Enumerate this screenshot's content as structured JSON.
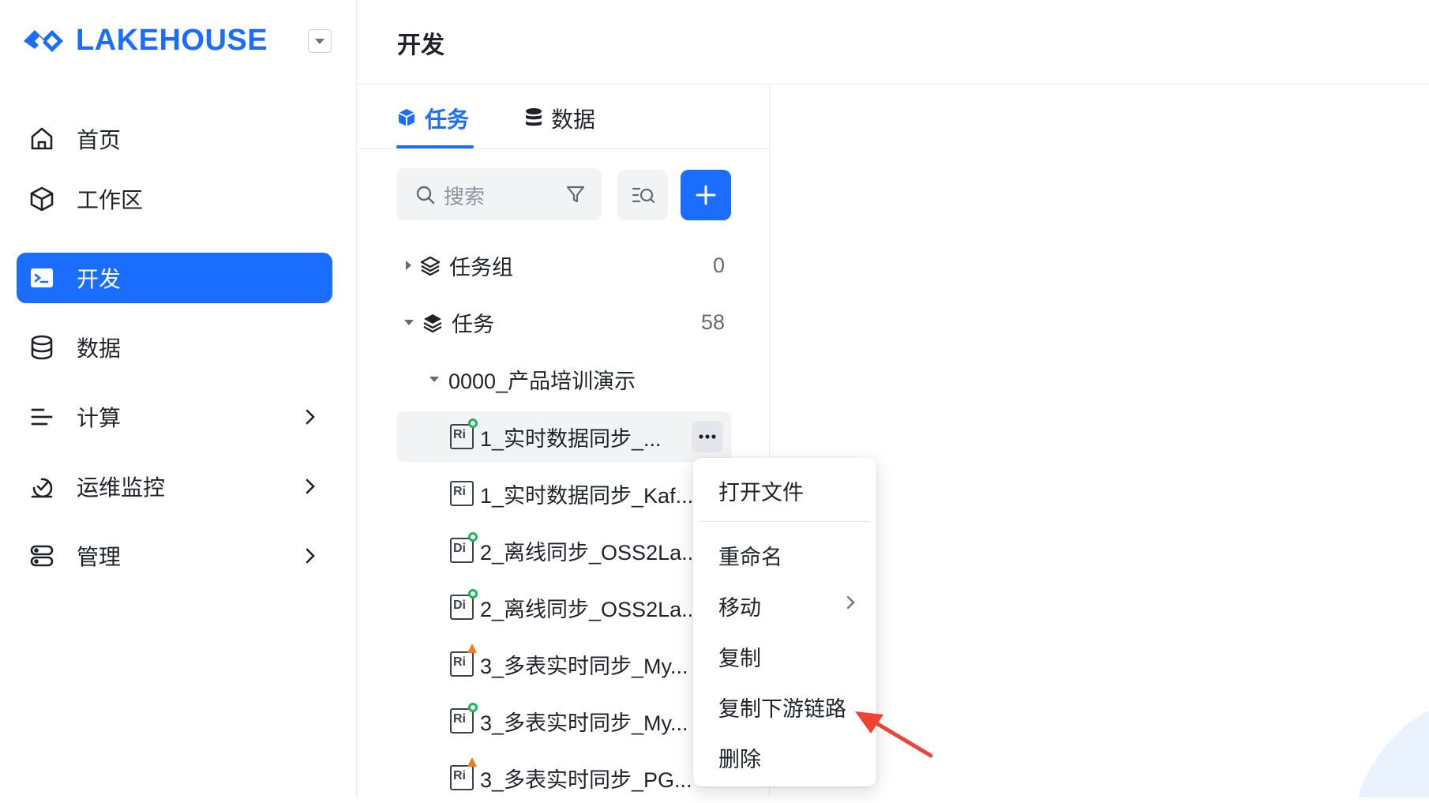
{
  "brand": {
    "name": "LAKEHOUSE",
    "accent": "#1a6dff"
  },
  "sidebar": {
    "items": [
      {
        "label": "首页",
        "icon": "home-icon"
      },
      {
        "label": "工作区",
        "icon": "cube-icon"
      },
      {
        "label": "开发",
        "icon": "terminal-icon",
        "active": true
      },
      {
        "label": "数据",
        "icon": "database-icon"
      },
      {
        "label": "计算",
        "icon": "compute-icon",
        "has_submenu": true
      },
      {
        "label": "运维监控",
        "icon": "monitor-icon",
        "has_submenu": true
      },
      {
        "label": "管理",
        "icon": "manage-icon",
        "has_submenu": true
      }
    ]
  },
  "header": {
    "title": "开发"
  },
  "panel": {
    "tabs": [
      {
        "label": "任务",
        "active": true
      },
      {
        "label": "数据"
      }
    ],
    "search": {
      "placeholder": "搜索"
    },
    "tree": {
      "task_group": {
        "label": "任务组",
        "count": "0"
      },
      "tasks": {
        "label": "任务",
        "count": "58"
      },
      "folder": {
        "label": "0000_产品培训演示"
      },
      "files": [
        {
          "label": "1_实时数据同步_...",
          "type": "Ri",
          "status": "green"
        },
        {
          "label": "1_实时数据同步_Kaf...",
          "type": "Ri",
          "status": "none"
        },
        {
          "label": "2_离线同步_OSS2La...",
          "type": "Di",
          "status": "green"
        },
        {
          "label": "2_离线同步_OSS2La...",
          "type": "Di",
          "status": "green"
        },
        {
          "label": "3_多表实时同步_My...",
          "type": "Ri",
          "status": "orange"
        },
        {
          "label": "3_多表实时同步_My...",
          "type": "Ri",
          "status": "green"
        },
        {
          "label": "3_多表实时同步_PG...",
          "type": "Ri",
          "status": "orange"
        }
      ]
    }
  },
  "context_menu": {
    "items": [
      {
        "label": "打开文件"
      },
      {
        "label": "重命名"
      },
      {
        "label": "移动",
        "has_submenu": true
      },
      {
        "label": "复制"
      },
      {
        "label": "复制下游链路"
      },
      {
        "label": "删除"
      }
    ]
  },
  "colors": {
    "status_green": "#1eb55a",
    "status_orange": "#f57a1f",
    "annotation_arrow": "#ee4433"
  }
}
